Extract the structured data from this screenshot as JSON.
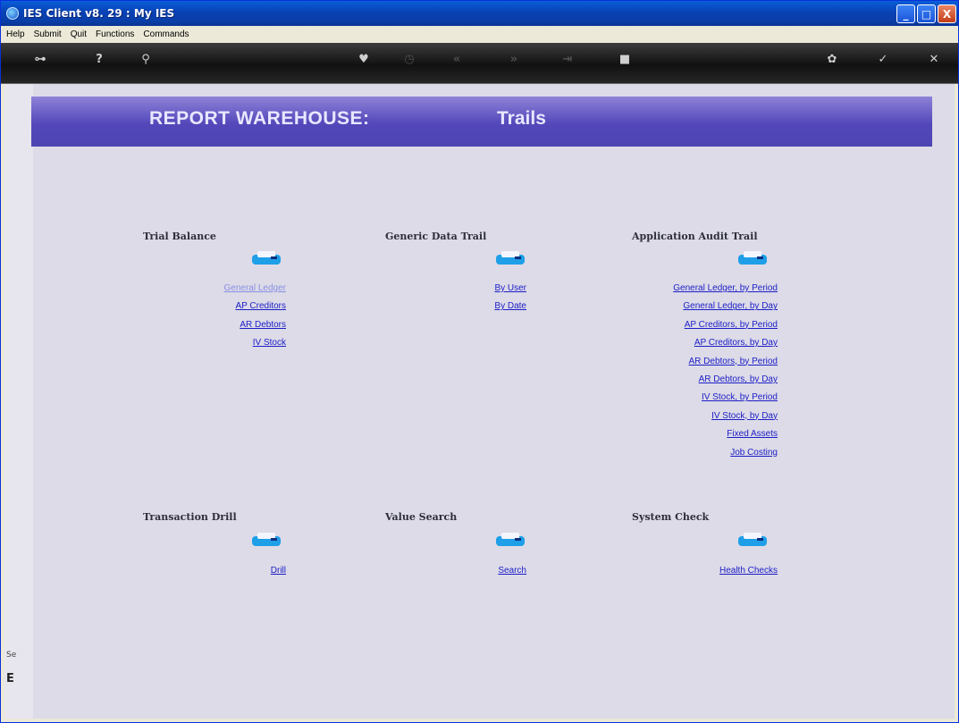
{
  "window": {
    "title": "IES Client v8. 29 : My IES",
    "buttons": {
      "minimize": "_",
      "maximize": "□",
      "close": "X"
    }
  },
  "menu": [
    "Help",
    "Submit",
    "Quit",
    "Functions",
    "Commands"
  ],
  "toolbar": [
    {
      "name": "key-icon",
      "glyph": "⊶",
      "enabled": true
    },
    {
      "name": "help-icon",
      "glyph": "?",
      "enabled": true
    },
    {
      "name": "search-icon",
      "glyph": "⚲",
      "enabled": true
    },
    {
      "name": "heart-icon",
      "glyph": "♥",
      "enabled": true
    },
    {
      "name": "clock-icon",
      "glyph": "◷",
      "enabled": false
    },
    {
      "name": "rewind-icon",
      "glyph": "«",
      "enabled": false
    },
    {
      "name": "forward-icon",
      "glyph": "»",
      "enabled": false
    },
    {
      "name": "end-icon",
      "glyph": "⇥",
      "enabled": false
    },
    {
      "name": "stop-icon",
      "glyph": "■",
      "enabled": true
    },
    {
      "name": "settings-icon",
      "glyph": "✿",
      "enabled": true
    },
    {
      "name": "ok-icon",
      "glyph": "✓",
      "enabled": true
    },
    {
      "name": "cancel-icon",
      "glyph": "✕",
      "enabled": true
    }
  ],
  "left_strip": {
    "frag1": "Se",
    "frag2": "E"
  },
  "banner": {
    "title": "REPORT WAREHOUSE:",
    "subtitle": "Trails"
  },
  "sections": {
    "trial_balance": {
      "heading": "Trial Balance",
      "links": [
        "General Ledger",
        "AP Creditors",
        "AR Debtors",
        "IV Stock"
      ]
    },
    "generic_data_trail": {
      "heading": "Generic Data Trail",
      "links": [
        "By User",
        "By Date"
      ]
    },
    "application_audit_trail": {
      "heading": "Application Audit Trail",
      "links": [
        "General Ledger, by Period",
        "General Ledger, by Day",
        "AP Creditors, by Period",
        "AP Creditors, by Day",
        "AR Debtors, by Period",
        "AR Debtors, by Day",
        "IV Stock, by Period",
        "IV Stock, by Day",
        "Fixed Assets",
        "Job Costing"
      ]
    },
    "transaction_drill": {
      "heading": "Transaction Drill",
      "links": [
        "Drill"
      ]
    },
    "value_search": {
      "heading": "Value Search",
      "links": [
        "Search"
      ]
    },
    "system_check": {
      "heading": "System Check",
      "links": [
        "Health Checks"
      ]
    }
  },
  "colors": {
    "banner": "#5347ba",
    "link": "#1d1dc8",
    "visited_link": "#8a8fe4",
    "content_bg": "#dcdbe7"
  }
}
